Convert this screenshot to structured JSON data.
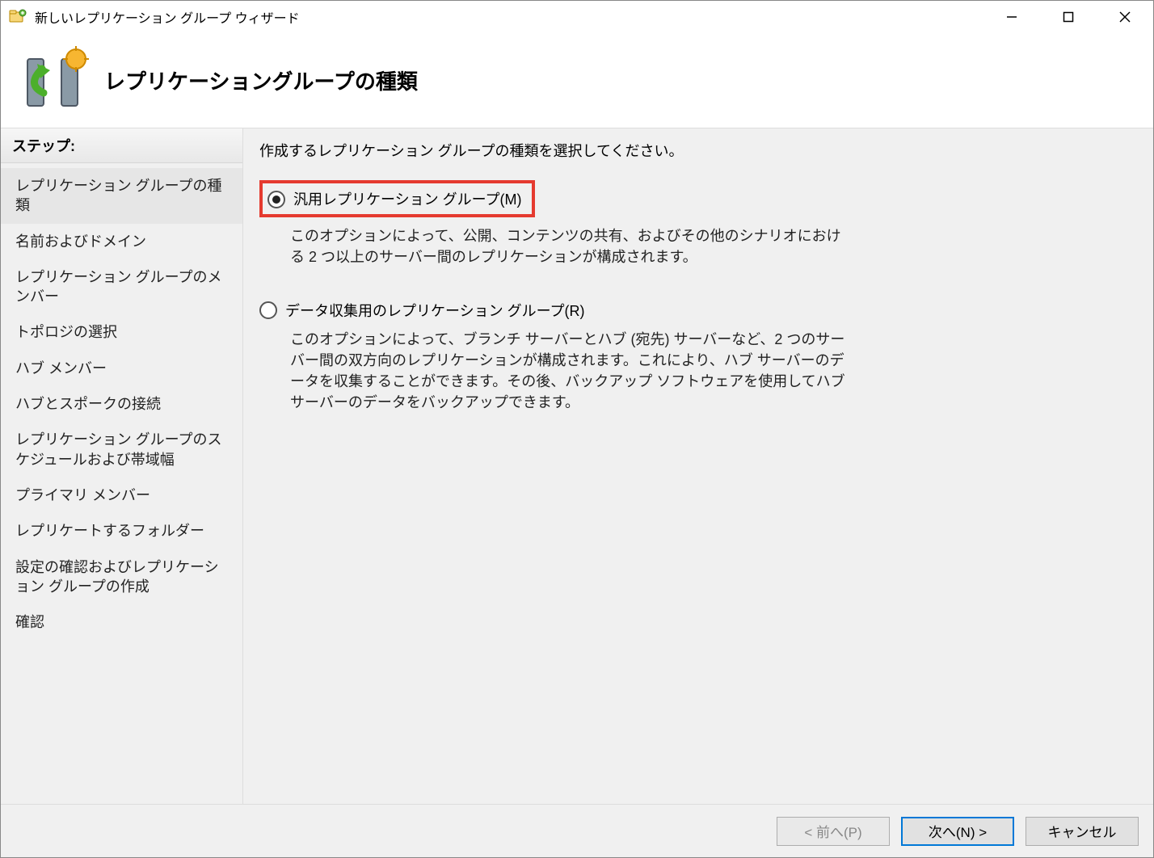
{
  "window": {
    "title": "新しいレプリケーション グループ ウィザード"
  },
  "header": {
    "title": "レプリケーショングループの種類"
  },
  "sidebar": {
    "header": "ステップ:",
    "items": [
      "レプリケーション グループの種類",
      "名前およびドメイン",
      "レプリケーション グループのメンバー",
      "トポロジの選択",
      "ハブ メンバー",
      "ハブとスポークの接続",
      "レプリケーション グループのスケジュールおよび帯域幅",
      "プライマリ メンバー",
      "レプリケートするフォルダー",
      "設定の確認およびレプリケーション グループの作成",
      "確認"
    ],
    "active_index": 0
  },
  "content": {
    "instruction": "作成するレプリケーション グループの種類を選択してください。",
    "options": [
      {
        "label": "汎用レプリケーション グループ(M)",
        "description": "このオプションによって、公開、コンテンツの共有、およびその他のシナリオにおける 2 つ以上のサーバー間のレプリケーションが構成されます。",
        "selected": true,
        "highlighted": true
      },
      {
        "label": "データ収集用のレプリケーション グループ(R)",
        "description": "このオプションによって、ブランチ サーバーとハブ (宛先) サーバーなど、2 つのサーバー間の双方向のレプリケーションが構成されます。これにより、ハブ サーバーのデータを収集することができます。その後、バックアップ ソフトウェアを使用してハブ サーバーのデータをバックアップできます。",
        "selected": false,
        "highlighted": false
      }
    ]
  },
  "footer": {
    "back": "< 前へ(P)",
    "next": "次へ(N) >",
    "cancel": "キャンセル"
  }
}
